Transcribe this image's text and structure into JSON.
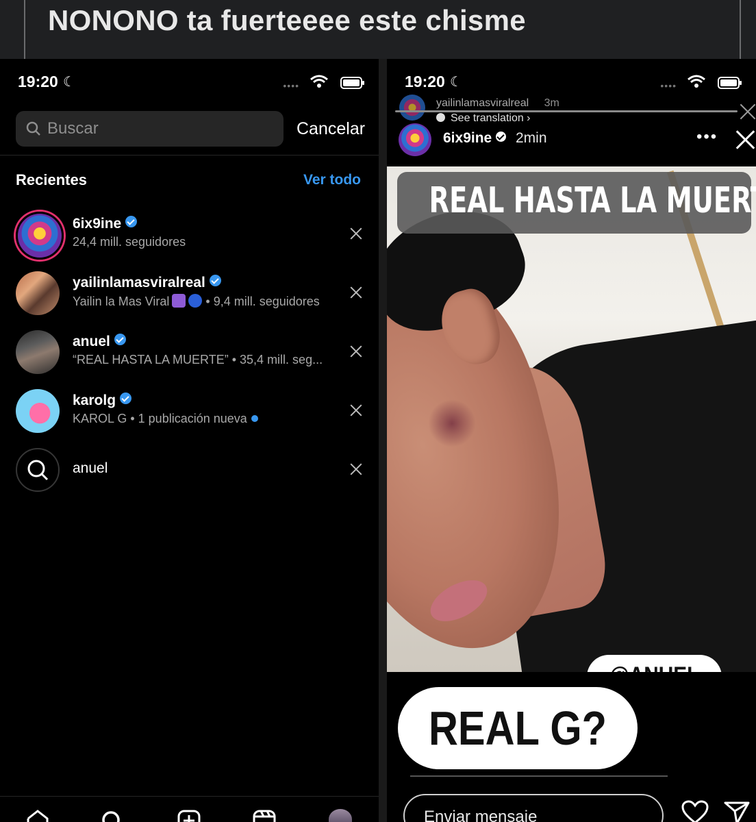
{
  "caption": {
    "text": "NONONO ta fuerteeee este chisme"
  },
  "left_phone": {
    "status": {
      "time": "19:20"
    },
    "search": {
      "placeholder": "Buscar",
      "cancel_label": "Cancelar"
    },
    "recents": {
      "heading": "Recientes",
      "see_all_label": "Ver todo",
      "items": [
        {
          "name": "6ix9ine",
          "verified": true,
          "subtitle": "24,4 mill. seguidores"
        },
        {
          "name": "yailinlamasviralreal",
          "verified": true,
          "subtitle_prefix": "Yailin la Mas Viral",
          "subtitle_suffix": "• 9,4 mill. seguidores"
        },
        {
          "name": "anuel",
          "verified": true,
          "subtitle": "“REAL HASTA LA MUERTE” • 35,4 mill. seg..."
        },
        {
          "name": "karolg",
          "verified": true,
          "subtitle": "KAROL G • 1 publicación nueva"
        },
        {
          "name": "anuel",
          "type": "search-term"
        }
      ]
    },
    "bottom_nav": [
      "home-icon",
      "search-icon",
      "create-post-icon",
      "reels-icon",
      "profile-avatar"
    ]
  },
  "right_phone": {
    "status": {
      "time": "19:20"
    },
    "previous_story": {
      "user": "yailinlamasviralreal",
      "time": "3m",
      "see_translation": "See translation"
    },
    "story": {
      "user": "6ix9ine",
      "verified": true,
      "time": "2min",
      "title_text": "REAL HASTA LA MUERTE",
      "mention": "@ANUEL",
      "reply_sticker": "REAL G?"
    },
    "message": {
      "placeholder": "Enviar mensaje"
    }
  },
  "colors": {
    "background": "#000000",
    "accent_blue": "#3897f0",
    "caption_bg": "#1f2022",
    "search_bg": "#262626"
  }
}
